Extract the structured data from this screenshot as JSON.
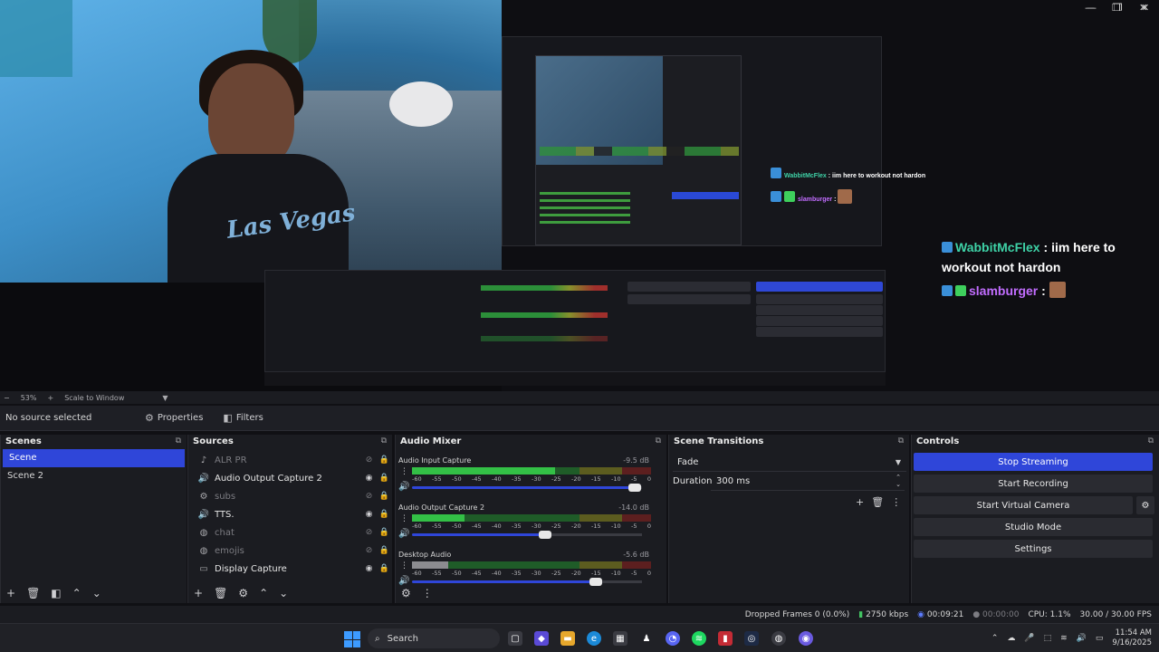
{
  "window": {
    "minimize": "—",
    "restore": "❐",
    "close": "✕"
  },
  "preview": {
    "webcam_shirt_text": "Las Vegas",
    "chat": [
      {
        "user": "WabbitMcFlex",
        "sep": " : ",
        "message": "iim here to workout not hardon",
        "color": "#3ed1a6"
      },
      {
        "user": "slamburger",
        "sep": " : ",
        "message": "",
        "color": "#c26dff"
      }
    ]
  },
  "zoom_row": {
    "zoom": "53%",
    "scale_mode": "Scale to Window"
  },
  "toolbar": {
    "no_source": "No source selected",
    "properties": "Properties",
    "filters": "Filters"
  },
  "scenes": {
    "title": "Scenes",
    "items": [
      {
        "label": "Scene",
        "active": true
      },
      {
        "label": "Scene 2",
        "active": false
      }
    ]
  },
  "sources": {
    "title": "Sources",
    "items": [
      {
        "label": "ALR PR",
        "icon": "music-note-icon",
        "visible": false
      },
      {
        "label": "Audio Output Capture 2",
        "icon": "speaker-icon",
        "visible": true
      },
      {
        "label": "subs",
        "icon": "gear-icon",
        "visible": false
      },
      {
        "label": "TTS.",
        "icon": "speaker-icon",
        "visible": true
      },
      {
        "label": "chat",
        "icon": "globe-icon",
        "visible": false
      },
      {
        "label": "emojis",
        "icon": "globe-icon",
        "visible": false
      },
      {
        "label": "Display Capture",
        "icon": "monitor-icon",
        "visible": true
      }
    ]
  },
  "mixer": {
    "title": "Audio Mixer",
    "ticks": [
      "-60",
      "-55",
      "-50",
      "-45",
      "-40",
      "-35",
      "-30",
      "-25",
      "-20",
      "-15",
      "-10",
      "-5",
      "0"
    ],
    "channels": [
      {
        "name": "Audio Input Capture",
        "db": "-9.5 dB",
        "level": 0.6,
        "volume": 0.97
      },
      {
        "name": "Audio Output Capture 2",
        "db": "-14.0 dB",
        "level": 0.22,
        "volume": 0.58
      },
      {
        "name": "Desktop Audio",
        "db": "-5.6 dB",
        "level": 0.15,
        "volume": 0.8
      }
    ]
  },
  "transitions": {
    "title": "Scene Transitions",
    "selected": "Fade",
    "duration_label": "Duration",
    "duration_value": "300 ms"
  },
  "controls": {
    "title": "Controls",
    "buttons": [
      "Stop Streaming",
      "Start Recording",
      "Start Virtual Camera",
      "Studio Mode",
      "Settings"
    ]
  },
  "statusbar": {
    "dropped": "Dropped Frames 0 (0.0%)",
    "bitrate": "2750 kbps",
    "stream_time": "00:09:21",
    "rec_time": "00:00:00",
    "cpu": "CPU: 1.1%",
    "fps": "30.00 / 30.00 FPS"
  },
  "taskbar": {
    "search": "Search",
    "time": "11:54 AM",
    "date": "9/16/2025"
  },
  "colors": {
    "accent": "#2f46d9",
    "live_green": "#41c462"
  }
}
